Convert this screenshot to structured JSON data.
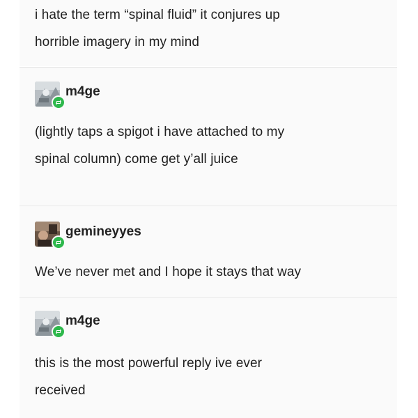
{
  "thread": {
    "original_post": {
      "text_line1": "i hate the term “spinal fluid” it conjures up",
      "text_line2": "horrible imagery in my mind"
    },
    "reply1": {
      "username": "m4ge",
      "avatar_icon": "avatar-image-icon",
      "badge_icon": "reblog-icon",
      "text_line1": "(lightly taps a spigot i have attached to my",
      "text_line2": "spinal column) come get y’all juice"
    },
    "reply2": {
      "username": "gemineyyes",
      "avatar_icon": "avatar-image-icon",
      "badge_icon": "reblog-icon",
      "text_line1": "We’ve never met and I hope it stays that way"
    },
    "reply3": {
      "username": "m4ge",
      "avatar_icon": "avatar-image-icon",
      "badge_icon": "reblog-icon",
      "text_line1": "this is the most powerful reply ive ever",
      "text_line2": "received"
    }
  },
  "colors": {
    "reblog_badge": "#2eb84c",
    "post_background": "#fafafa",
    "separator": "#e4e4e4",
    "text": "#1f1f1f"
  }
}
